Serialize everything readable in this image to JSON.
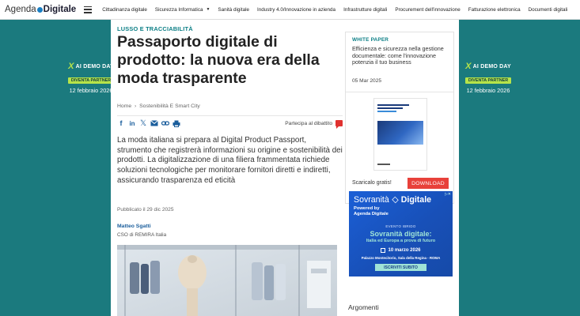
{
  "nav": {
    "logo_part1": "Agenda",
    "logo_part2": "Digitale",
    "items": [
      {
        "label": "Cittadinanza digitale"
      },
      {
        "label": "Sicurezza Informatica",
        "caret": "▼"
      },
      {
        "label": "Sanità digitale"
      },
      {
        "label": "Industry 4.0/Innovazione in azienda"
      },
      {
        "label": "Infrastrutture digitali"
      },
      {
        "label": "Procurement dell'innovazione"
      },
      {
        "label": "Fatturazione elettronica"
      },
      {
        "label": "Documenti digitali"
      }
    ]
  },
  "side_banner": {
    "title": "AI DEMO DAY",
    "partner": "DIVENTA PARTNER",
    "date": "12 febbraio 2026"
  },
  "article": {
    "kicker": "LUSSO E TRACCIABILITÀ",
    "title": "Passaporto digitale di prodotto: la nuova era della moda trasparente",
    "breadcrumb": {
      "home": "Home",
      "section": "Sostenibilità E Smart City"
    },
    "discussion": "Partecipa al dibattito",
    "lead": "La moda italiana si prepara al Digital Product Passport, strumento che registrerà informazioni su origine e sostenibilità dei prodotti. La digitalizzazione di una filiera frammentata richiede soluzioni tecnologiche per monitorare fornitori diretti e indiretti, assicurando trasparenza ed eticità",
    "published": "Pubblicato il 29 dic 2025",
    "author": {
      "name": "Matteo Sgatti",
      "role": "CSO di REMIRA Italia"
    }
  },
  "share_icons": [
    "facebook-icon",
    "linkedin-icon",
    "x-icon",
    "email-icon",
    "link-icon",
    "print-icon"
  ],
  "whitepaper": {
    "label": "WHITE PAPER",
    "title": "Efficienza e sicurezza nella gestione documentale: come l'innovazione potenzia il tuo business",
    "date": "05 Mar 2025",
    "download_text": "Scaricalo gratis!",
    "download_button": "DOWNLOAD"
  },
  "ad": {
    "headline_pre": "Sovranità",
    "headline_post": "Digitale",
    "powered_by": "Powered by",
    "powered_brand": "Agenda Digitale",
    "event_type": "EVENTO IBRIDO",
    "event_title": "Sovranità digitale:",
    "event_subtitle": "Italia ed Europa a prova di futuro",
    "event_date": "10 marzo 2026",
    "place": "Palazzo Montecitorio, Sala della Regina - ROMA",
    "cta": "ISCRIVITI SUBITO"
  },
  "sidebar": {
    "arguments_title": "Argomenti"
  },
  "colors": {
    "background": "#1b7a7e",
    "accent": "#0c7f86",
    "download": "#e8413a",
    "partner": "#b6e34a"
  }
}
